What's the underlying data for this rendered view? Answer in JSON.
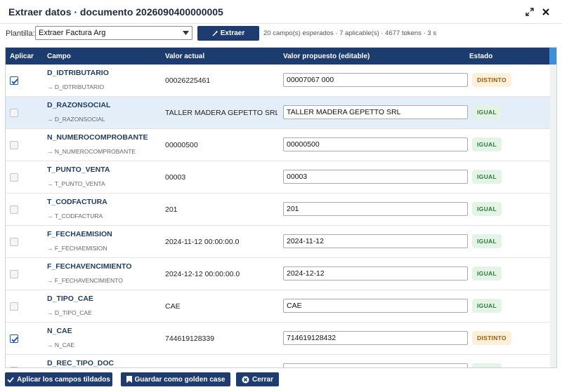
{
  "window": {
    "title": "Extraer datos · documento 2026090400000005"
  },
  "toolbar": {
    "template_label": "Plantilla:",
    "template_value": "Extraer Factura Arg",
    "extract_label": "Extraer",
    "stats": "20 campo(s) esperados · 7 aplicable(s) · 4677 tokens · 3 s"
  },
  "table": {
    "headers": {
      "apply": "Aplicar",
      "field": "Campo",
      "current": "Valor actual",
      "proposed": "Valor propuesto (editable)",
      "status": "Estado"
    },
    "rows": [
      {
        "checked": true,
        "field": "D_IDTRIBUTARIO",
        "sub": "→ D_IDTRIBUTARIO",
        "current": "00026225461",
        "proposed": "00007067 000",
        "status": "DISTINTO",
        "highlight": false
      },
      {
        "checked": false,
        "field": "D_RAZONSOCIAL",
        "sub": "→ D_RAZONSOCIAL",
        "current": "TALLER MADERA GEPETTO SRL",
        "proposed": "TALLER MADERA GEPETTO SRL",
        "status": "IGUAL",
        "highlight": true
      },
      {
        "checked": false,
        "field": "N_NUMEROCOMPROBANTE",
        "sub": "→ N_NUMEROCOMPROBANTE",
        "current": "00000500",
        "proposed": "00000500",
        "status": "IGUAL",
        "highlight": false
      },
      {
        "checked": false,
        "field": "T_PUNTO_VENTA",
        "sub": "→ T_PUNTO_VENTA",
        "current": "00003",
        "proposed": "00003",
        "status": "IGUAL",
        "highlight": false
      },
      {
        "checked": false,
        "field": "T_CODFACTURA",
        "sub": "→ T_CODFACTURA",
        "current": "201",
        "proposed": "201",
        "status": "IGUAL",
        "highlight": false
      },
      {
        "checked": false,
        "field": "F_FECHAEMISION",
        "sub": "→ F_FECHAEMISION",
        "current": "2024-11-12 00:00:00.0",
        "proposed": "2024-11-12",
        "status": "IGUAL",
        "highlight": false
      },
      {
        "checked": false,
        "field": "F_FECHAVENCIMIENTO",
        "sub": "→ F_FECHAVENCIMIENTO",
        "current": "2024-12-12 00:00:00.0",
        "proposed": "2024-12-12",
        "status": "IGUAL",
        "highlight": false
      },
      {
        "checked": false,
        "field": "D_TIPO_CAE",
        "sub": "→ D_TIPO_CAE",
        "current": "CAE",
        "proposed": "CAE",
        "status": "IGUAL",
        "highlight": false
      },
      {
        "checked": true,
        "field": "N_CAE",
        "sub": "→ N_CAE",
        "current": "744619128339",
        "proposed": "714619128432",
        "status": "DISTINTO",
        "highlight": false
      },
      {
        "checked": false,
        "field": "D_REC_TIPO_DOC",
        "sub": "",
        "current": "",
        "proposed": "",
        "status": "IGUAL",
        "highlight": false
      }
    ]
  },
  "footer": {
    "apply_label": "Aplicar los campos tildados",
    "golden_label": "Guardar como golden case",
    "close_label": "Cerrar"
  },
  "colors": {
    "header_bg": "#1c3b6e",
    "button_bg": "#1f3c71",
    "igual_bg": "#e3f3e6",
    "distinto_bg": "#fdf0da"
  },
  "icons": {
    "expand": "expand-icon",
    "close": "close-icon",
    "dropdown": "chevron-down-icon",
    "extract": "wand-icon",
    "apply": "check-icon",
    "save": "bookmark-icon",
    "cancel": "close-circle-icon"
  }
}
